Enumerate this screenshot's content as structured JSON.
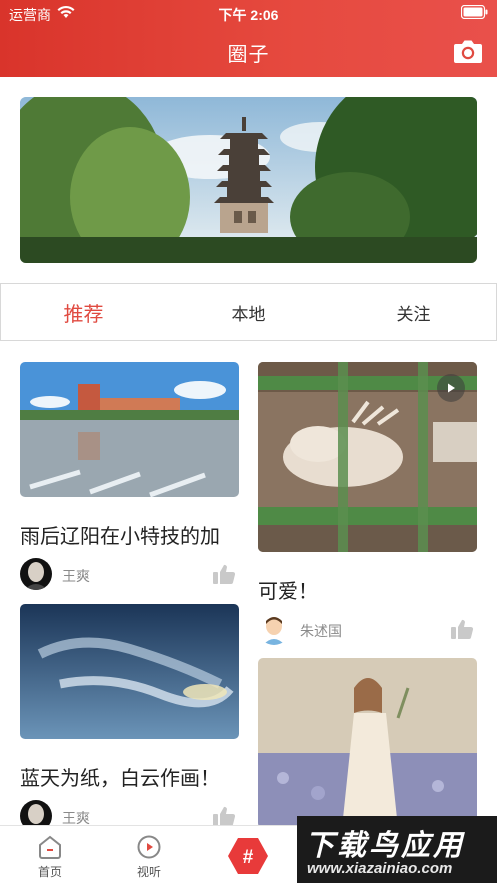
{
  "status_bar": {
    "carrier": "运营商",
    "time": "下午 2:06"
  },
  "header": {
    "title": "圈子"
  },
  "tabs": [
    {
      "label": "推荐",
      "active": true
    },
    {
      "label": "本地",
      "active": false
    },
    {
      "label": "关注",
      "active": false
    }
  ],
  "feed": {
    "left": [
      {
        "title": "雨后辽阳在小特技的加",
        "author": "王爽",
        "avatar_icon": "portrait-avatar"
      },
      {
        "title": "蓝天为纸，白云作画！",
        "author": "王爽",
        "avatar_icon": "portrait-avatar"
      }
    ],
    "right": [
      {
        "title": "可爱！",
        "author": "朱述国",
        "avatar_icon": "cartoon-boy-avatar",
        "is_video": true
      },
      {
        "title": "",
        "author": "",
        "avatar_icon": ""
      }
    ]
  },
  "tabbar": [
    {
      "label": "首页",
      "icon": "home-icon"
    },
    {
      "label": "视听",
      "icon": "play-circle-icon"
    },
    {
      "label": "#",
      "icon": "hash-button"
    }
  ],
  "watermark": {
    "main": "下载鸟应用",
    "url": "www.xiazainiao.com"
  },
  "colors": {
    "accent": "#e04a40",
    "header": "#d9342b",
    "hash_button": "#e83a3a"
  }
}
